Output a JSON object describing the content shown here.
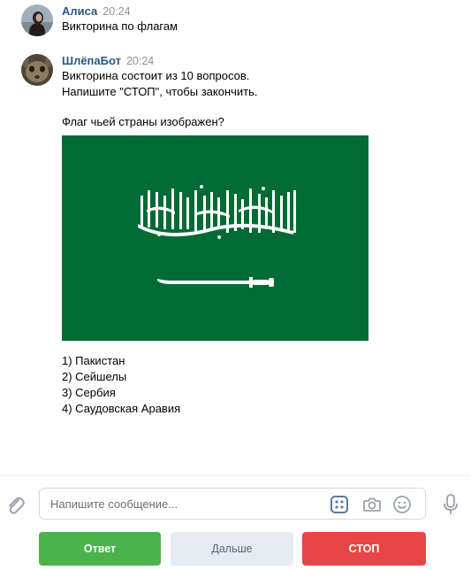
{
  "messages": [
    {
      "author": "Алиса",
      "time": "20:24",
      "lines": [
        "Викторина по флагам"
      ]
    },
    {
      "author": "ШлёпаБот",
      "time": "20:24",
      "intro": [
        "Викторина состоит из 10 вопросов.",
        "Напишите \"СТОП\", чтобы закончить."
      ],
      "question": "Флаг чьей страны изображен?",
      "options": [
        "1) Пакистан",
        "2) Сейшелы",
        "3) Сербия",
        "4) Саудовская Аравия"
      ]
    }
  ],
  "composer": {
    "placeholder": "Напишите сообщение...",
    "value": ""
  },
  "keyboard": {
    "answer": "Ответ",
    "next": "Дальше",
    "stop": "СТОП"
  },
  "colors": {
    "author": "#2a5885",
    "flag_green": "#006b35",
    "button_green": "#4bb34b",
    "button_red": "#e64646",
    "button_gray": "#e5ebf1"
  },
  "icons": [
    "attach-icon",
    "keyboard-icon",
    "camera-icon",
    "smile-icon",
    "microphone-icon"
  ]
}
